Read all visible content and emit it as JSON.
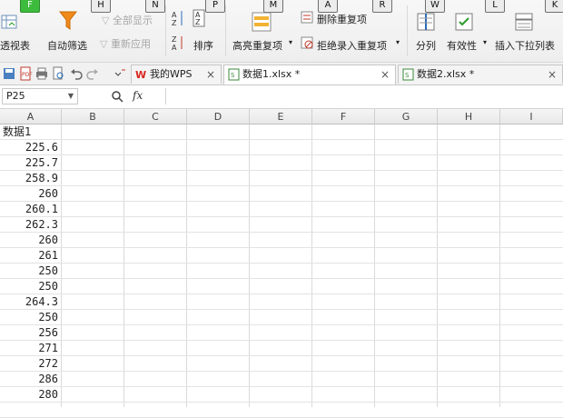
{
  "ribbon": {
    "keytips": [
      "F",
      "H",
      "N",
      "P",
      "M",
      "A",
      "R",
      "W",
      "L",
      "K"
    ],
    "pivot_label": "透视表",
    "autofilter_label": "自动筛选",
    "show_all_label": "全部显示",
    "reapply_label": "重新应用",
    "sort_label": "排序",
    "highlight_dup_label": "高亮重复项",
    "delete_dup_label": "删除重复项",
    "reject_dup_label": "拒绝录入重复项",
    "split_label": "分列",
    "validity_label": "有效性",
    "dropdown_label": "插入下拉列表"
  },
  "tabs": [
    {
      "label": "我的WPS",
      "close": "×"
    },
    {
      "label": "数据1.xlsx *",
      "close": "×"
    },
    {
      "label": "数据2.xlsx *",
      "close": "×"
    }
  ],
  "formula_bar": {
    "cell_ref": "P25",
    "fx_label": "fx",
    "formula": ""
  },
  "grid": {
    "columns": [
      "A",
      "B",
      "C",
      "D",
      "E",
      "F",
      "G",
      "H",
      "I"
    ],
    "header_cell": "数据1",
    "values": [
      "225.6",
      "225.7",
      "258.9",
      "260",
      "260.1",
      "262.3",
      "260",
      "261",
      "250",
      "250",
      "264.3",
      "250",
      "256",
      "271",
      "272",
      "286",
      "280"
    ]
  },
  "colors": {
    "accent_green": "#3dbb3d",
    "wps_red": "#d9261c",
    "funnel_orange": "#f08a1a"
  }
}
